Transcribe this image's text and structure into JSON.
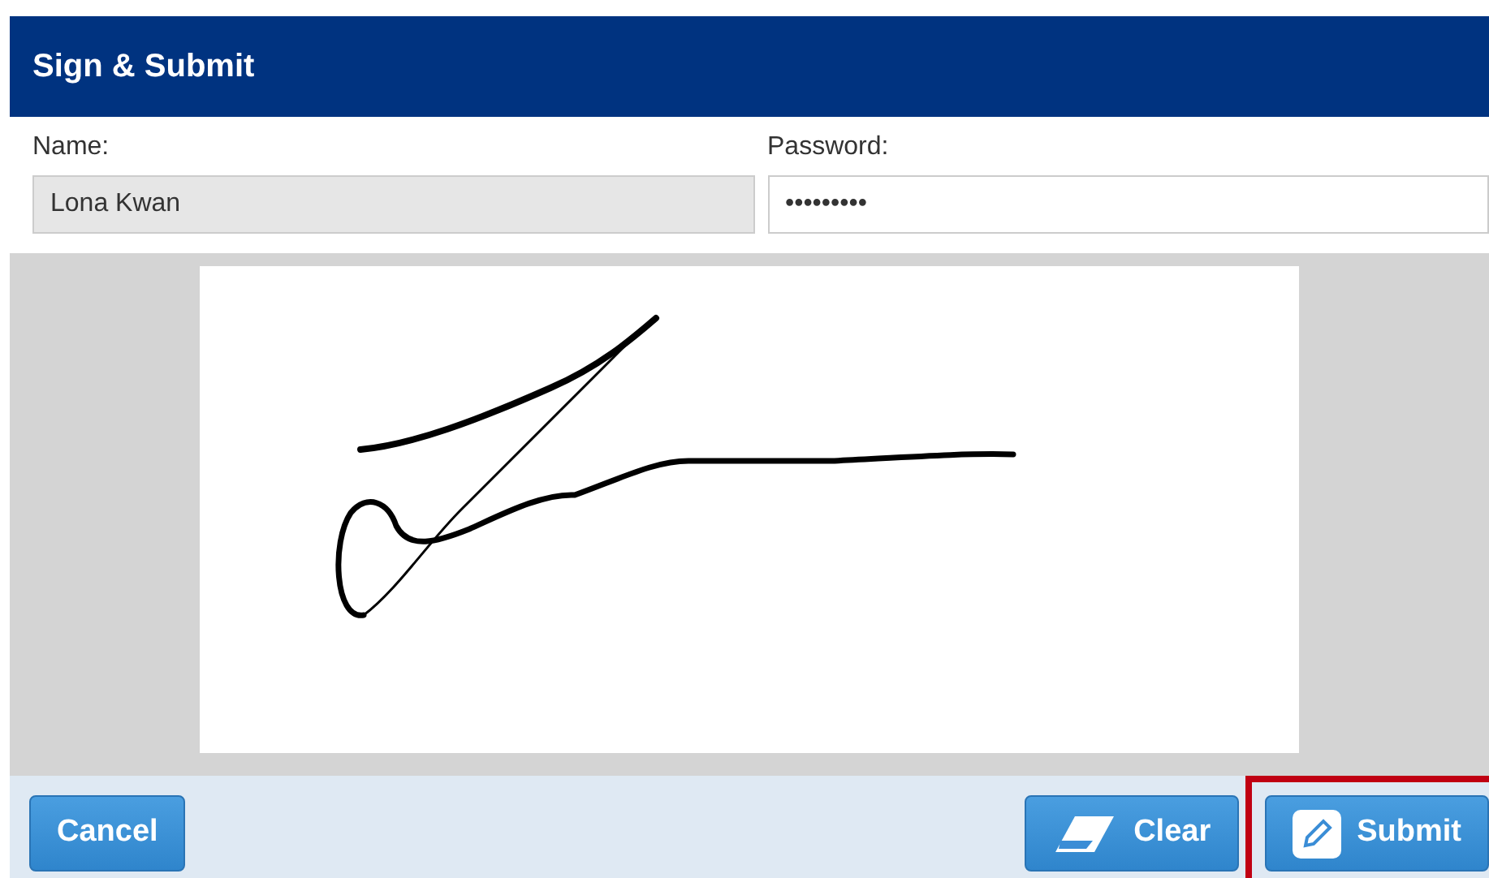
{
  "dialog": {
    "title": "Sign & Submit"
  },
  "fields": [
    {
      "label": "Name:",
      "value": "Lona Kwan",
      "disabled": true
    },
    {
      "label": "Password:",
      "value": "•••••••••",
      "disabled": false
    }
  ],
  "buttons": [
    {
      "label": "Cancel",
      "kind": "plain",
      "highlighted": false
    },
    {
      "label": "Clear",
      "kind": "eraser",
      "highlighted": false
    },
    {
      "label": "Submit",
      "kind": "pencil",
      "highlighted": true
    }
  ]
}
